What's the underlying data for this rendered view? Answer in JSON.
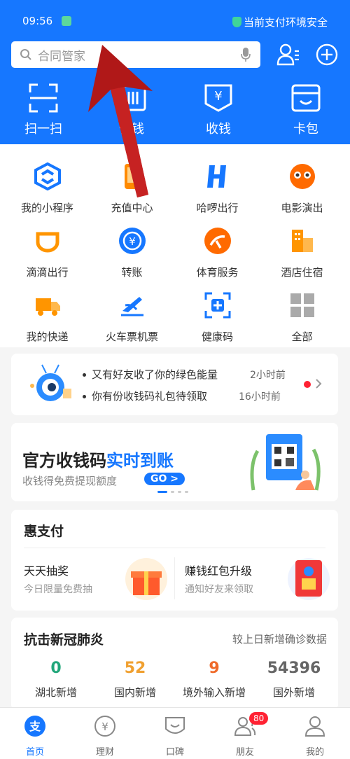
{
  "status_bar": {
    "time": "09:56",
    "safety_text": "当前支付环境安全"
  },
  "search": {
    "placeholder": "合同管家"
  },
  "quick_actions": [
    {
      "label": "扫一扫",
      "icon": "scan-icon"
    },
    {
      "label": "付钱",
      "icon": "pay-code-icon"
    },
    {
      "label": "收钱",
      "icon": "collect-money-icon"
    },
    {
      "label": "卡包",
      "icon": "card-wallet-icon"
    }
  ],
  "services": [
    {
      "label": "我的小程序",
      "icon": "mini-program-icon",
      "color": "#1677ff"
    },
    {
      "label": "充值中心",
      "icon": "phone-topup-icon",
      "color": "#ff8a00"
    },
    {
      "label": "哈啰出行",
      "icon": "hellobike-icon",
      "color": "#1677ff"
    },
    {
      "label": "电影演出",
      "icon": "movie-icon",
      "color": "#ff6a00"
    },
    {
      "label": "滴滴出行",
      "icon": "didi-icon",
      "color": "#ff9500"
    },
    {
      "label": "转账",
      "icon": "transfer-icon",
      "color": "#1677ff"
    },
    {
      "label": "体育服务",
      "icon": "sports-icon",
      "color": "#ff6a00"
    },
    {
      "label": "酒店住宿",
      "icon": "hotel-icon",
      "color": "#ff9500"
    },
    {
      "label": "我的快递",
      "icon": "express-icon",
      "color": "#ff9500"
    },
    {
      "label": "火车票机票",
      "icon": "train-plane-icon",
      "color": "#1677ff"
    },
    {
      "label": "健康码",
      "icon": "health-code-icon",
      "color": "#1677ff"
    },
    {
      "label": "全部",
      "icon": "all-grid-icon",
      "color": "#999999"
    }
  ],
  "notice": {
    "line1": "又有好友收了你的绿色能量",
    "time1": "2小时前",
    "line2": "你有份收钱码礼包待领取",
    "time2": "16小时前"
  },
  "promo": {
    "title_prefix": "官方收钱码",
    "title_highlight": "实时到账",
    "subtitle": "收钱得免费提现额度",
    "go_label": "GO >"
  },
  "hui": {
    "title": "惠支付",
    "items": [
      {
        "title": "天天抽奖",
        "subtitle": "今日限量免费抽"
      },
      {
        "title": "赚钱红包升级",
        "subtitle": "通知好友来领取"
      }
    ]
  },
  "covid": {
    "title": "抗击新冠肺炎",
    "subtitle": "较上日新增确诊数据",
    "stats": [
      {
        "value": "0",
        "label": "湖北新增",
        "color": "#21a67a"
      },
      {
        "value": "52",
        "label": "国内新增",
        "color": "#f0a030"
      },
      {
        "value": "9",
        "label": "境外输入新增",
        "color": "#ef6a2a"
      },
      {
        "value": "54396",
        "label": "国外新增",
        "color": "#666666"
      }
    ]
  },
  "tabbar": {
    "tabs": [
      {
        "label": "首页",
        "icon": "alipay-home-icon"
      },
      {
        "label": "理财",
        "icon": "wealth-icon"
      },
      {
        "label": "口碑",
        "icon": "koubei-icon"
      },
      {
        "label": "朋友",
        "icon": "friends-icon"
      },
      {
        "label": "我的",
        "icon": "me-icon"
      }
    ],
    "friends_badge": "80"
  },
  "colors": {
    "brand_blue": "#1677ff",
    "badge_red": "#ff2233"
  }
}
